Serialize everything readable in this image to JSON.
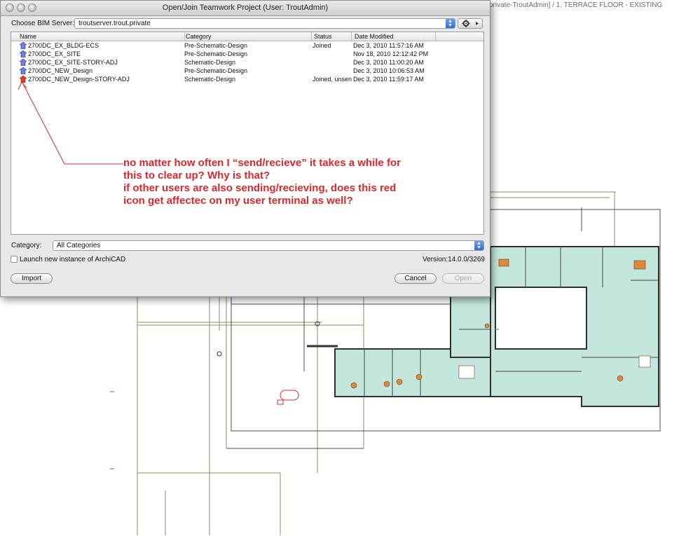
{
  "background": {
    "window_title": "private-TroutAdmin] / 1. TERRACE FLOOR - EXISTING"
  },
  "dialog": {
    "title": "Open/Join Teamwork Project (User: TroutAdmin)",
    "bim_server_label": "Choose BIM Server:",
    "bim_server_value": "troutserver.trout.private",
    "columns": [
      "Name",
      "Category",
      "Status",
      "Date Modified"
    ],
    "projects": [
      {
        "name": "2700DC_EX_BLDG-ECS",
        "category": "Pre-Schematic-Design",
        "status": "Joined",
        "date": "Dec 3, 2010 11:57:16 AM",
        "icon": "teamwork-project-icon"
      },
      {
        "name": "2700DC_EX_SITE",
        "category": "Pre-Schematic-Design",
        "status": "",
        "date": "Nov 18, 2010 12:12:42 PM",
        "icon": "teamwork-project-icon"
      },
      {
        "name": "2700DC_EX_SITE-STORY-ADJ",
        "category": "Schematic-Design",
        "status": "",
        "date": "Dec 3, 2010 11:00:20 AM",
        "icon": "teamwork-project-icon"
      },
      {
        "name": "2700DC_NEW_Design",
        "category": "Pre-Schematic-Design",
        "status": "",
        "date": "Dec 3, 2010 10:06:53 AM",
        "icon": "teamwork-project-icon"
      },
      {
        "name": "2700DC_NEW_Design-STORY-ADJ",
        "category": "Schematic-Design",
        "status": "Joined, unsen",
        "date": "Dec 3, 2010 11:59:17 AM",
        "icon": "unsent-changes-red-icon"
      }
    ],
    "category_label": "Category:",
    "category_value": "All Categories",
    "launch_label": "Launch new instance of ArchiCAD",
    "version": "Version:14.0.0/3269",
    "import_label": "Import",
    "cancel_label": "Cancel",
    "open_label": "Open"
  },
  "annotation": {
    "lines": [
      "no matter how often I “send/recieve” it takes a while for",
      "this to clear up? Why is that?",
      "if other users are also sending/recieving, does this red",
      "icon get affectec on my user terminal as well?"
    ],
    "color": "#e0262d"
  },
  "colors": {
    "floor_fill": "#bfe4dc",
    "grid_line": "#8a8a5a",
    "wall": "#333333",
    "accent": "#2d6fd8"
  }
}
